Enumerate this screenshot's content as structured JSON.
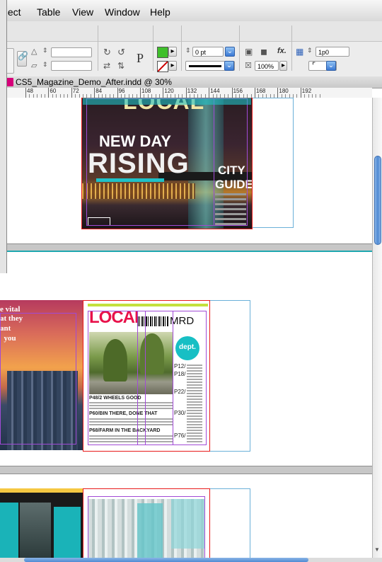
{
  "menubar": {
    "items": [
      "oject",
      "Table",
      "View",
      "Window",
      "Help"
    ]
  },
  "control_panel": {
    "stroke_weight": "0 pt",
    "opacity": "100%",
    "reference_value": "1p0",
    "fx_label": "fx.",
    "colors": {
      "fill": "#3fbf2b",
      "stroke_none": "#cc0000"
    }
  },
  "document": {
    "tab_title": "CS5_Magazine_Demo_After.indd @ 30%"
  },
  "ruler": {
    "labels": [
      "48",
      "60",
      "72",
      "84",
      "96",
      "108",
      "120",
      "132",
      "144",
      "156",
      "168",
      "180",
      "192"
    ]
  },
  "page1": {
    "masthead": "LOCAL",
    "headline1": "NEW DAY",
    "headline2": "RISING",
    "sidebar1": "CITY",
    "sidebar2": "GUIDE"
  },
  "spread2": {
    "left_text": [
      "e vital",
      "at they",
      "ant",
      "  you"
    ],
    "masthead": "LOCAL",
    "masthead_suffix": "MRD",
    "badge": "dept.",
    "items": [
      {
        "page": "P48/",
        "text": "2 WHEELS GOOD"
      },
      {
        "page": "P60/",
        "text": "BIN THERE, DONE THAT"
      },
      {
        "page": "P68/",
        "text": "FARM IN THE BACKYARD"
      }
    ],
    "right_pages": [
      "P12/",
      "P18/",
      "P22/",
      "P30/",
      "P76/"
    ]
  }
}
